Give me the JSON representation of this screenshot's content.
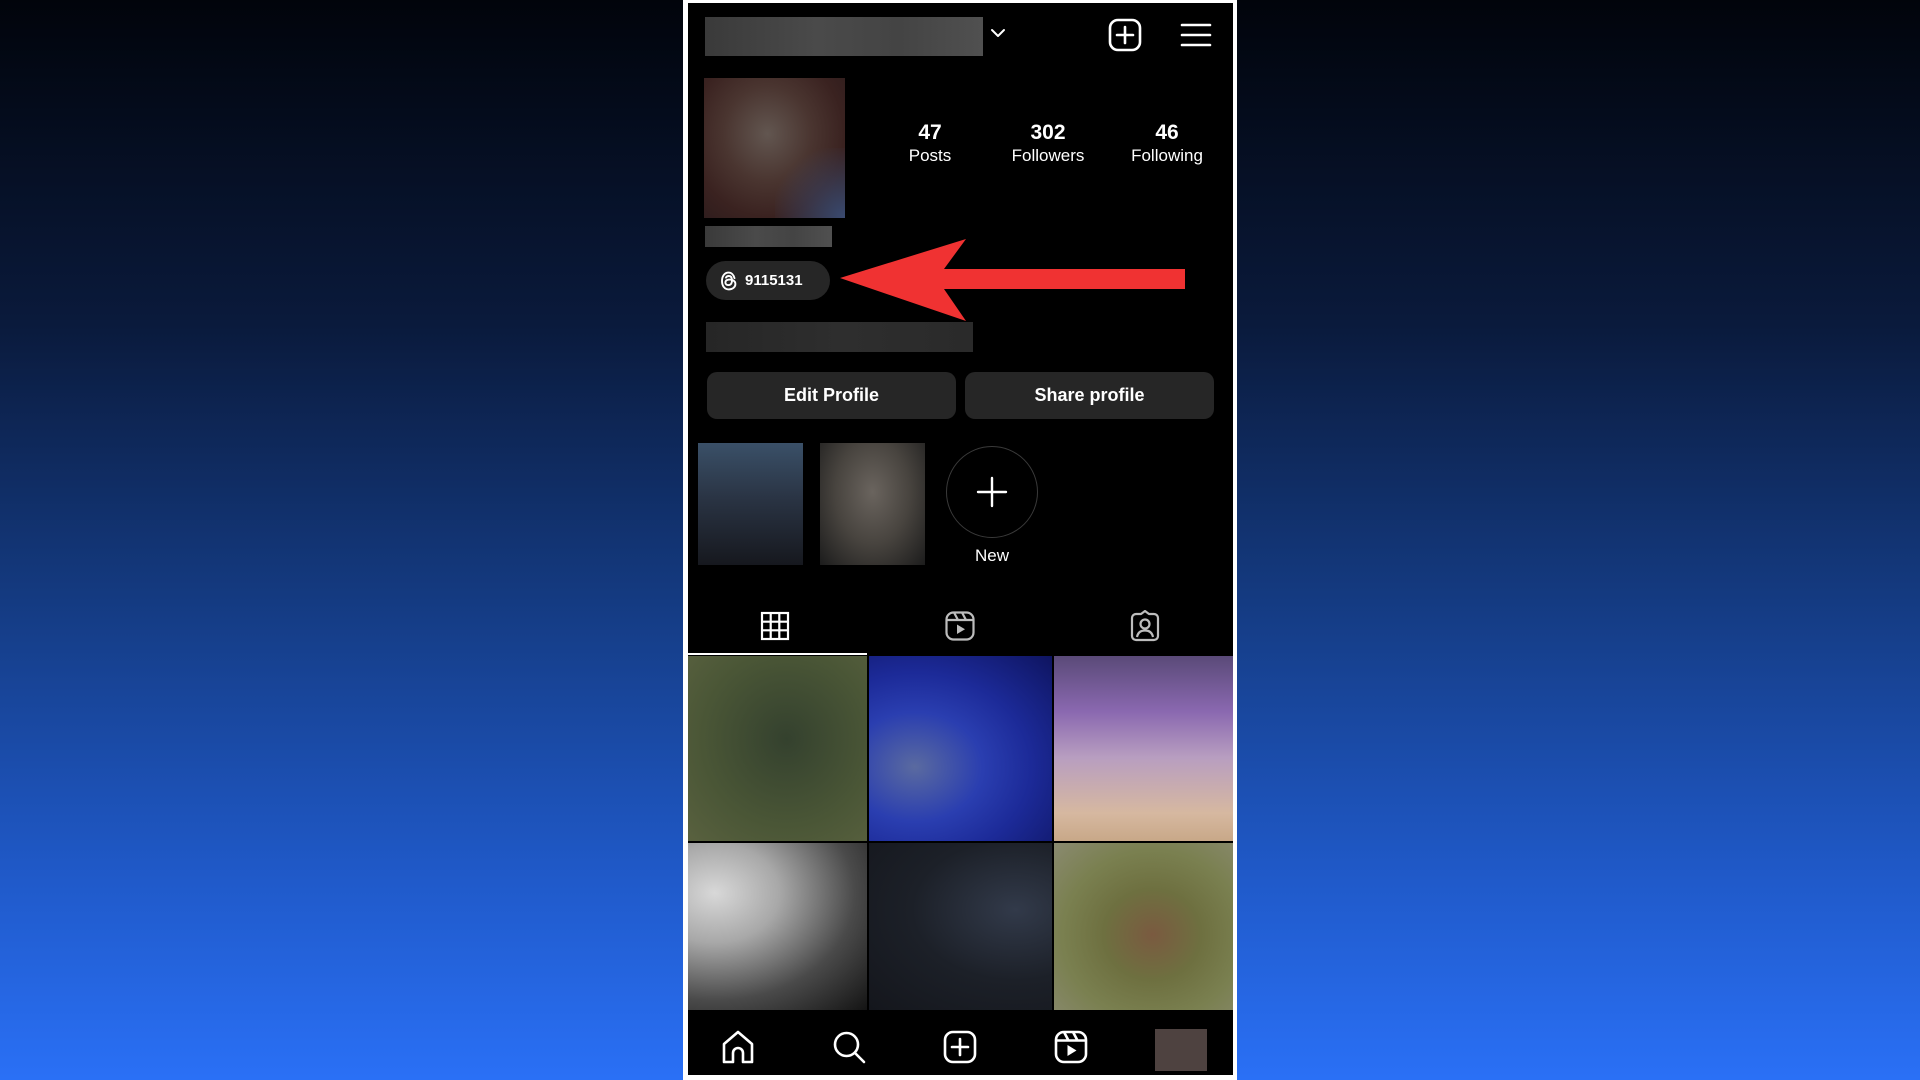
{
  "header": {
    "username": "",
    "icons": {
      "dropdown": "chevron-down-icon",
      "create": "plus-square-icon",
      "menu": "hamburger-menu-icon"
    }
  },
  "profile": {
    "stats": [
      {
        "value": "47",
        "label": "Posts"
      },
      {
        "value": "302",
        "label": "Followers"
      },
      {
        "value": "46",
        "label": "Following"
      }
    ],
    "threads_badge": {
      "icon": "threads-icon",
      "number": "9115131"
    }
  },
  "actions": {
    "edit_profile": "Edit Profile",
    "share_profile": "Share profile"
  },
  "highlights": {
    "new_label": "New",
    "new_icon": "plus-icon"
  },
  "tabs": [
    {
      "name": "posts",
      "icon": "grid-icon",
      "active": true
    },
    {
      "name": "reels",
      "icon": "reels-icon",
      "active": false
    },
    {
      "name": "tagged",
      "icon": "tagged-user-icon",
      "active": false
    }
  ],
  "bottom_nav": [
    {
      "name": "home",
      "icon": "home-icon"
    },
    {
      "name": "search",
      "icon": "search-icon"
    },
    {
      "name": "create",
      "icon": "plus-square-icon"
    },
    {
      "name": "reels",
      "icon": "reels-icon"
    },
    {
      "name": "profile",
      "icon": "avatar"
    }
  ],
  "colors": {
    "annotation_arrow": "#f03232",
    "background_top": "#01040b",
    "background_bottom": "#2a70f6",
    "button_bg": "#262626"
  }
}
